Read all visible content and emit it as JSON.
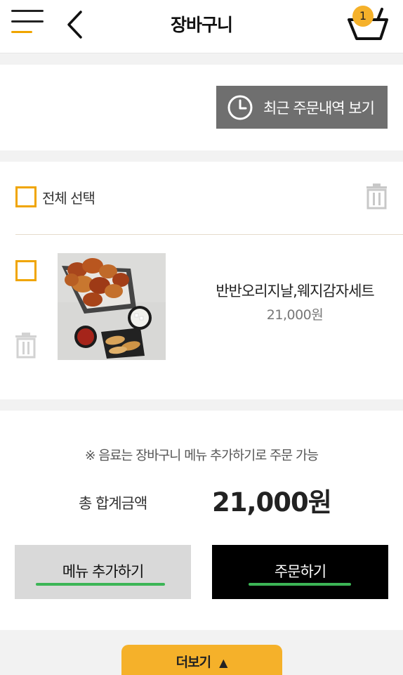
{
  "header": {
    "title": "장바구니",
    "cart_count": "1",
    "menu_icon": "hamburger-icon",
    "back_icon": "chevron-left-icon",
    "cart_icon": "basket-icon"
  },
  "recent": {
    "label": "최근 주문내역 보기",
    "icon": "clock-icon"
  },
  "cart": {
    "select_all_label": "전체 선택",
    "delete_icon": "trash-icon",
    "items": [
      {
        "name": "반반오리지날,웨지감자세트",
        "price": "21,000원",
        "image": "fried-chicken-with-wedges-photo"
      }
    ]
  },
  "summary": {
    "notice": "※ 음료는 장바구니 메뉴 추가하기로 주문 가능",
    "total_label": "총 합계금액",
    "total_value": "21,000원"
  },
  "actions": {
    "add_menu": "메뉴 추가하기",
    "order": "주문하기"
  },
  "footer": {
    "more_label": "더보기",
    "more_arrow": "▲"
  },
  "colors": {
    "accent": "#f0a500",
    "badge": "#f5b12a",
    "recent_button": "#6f6f6f",
    "underline": "#3cb556"
  }
}
